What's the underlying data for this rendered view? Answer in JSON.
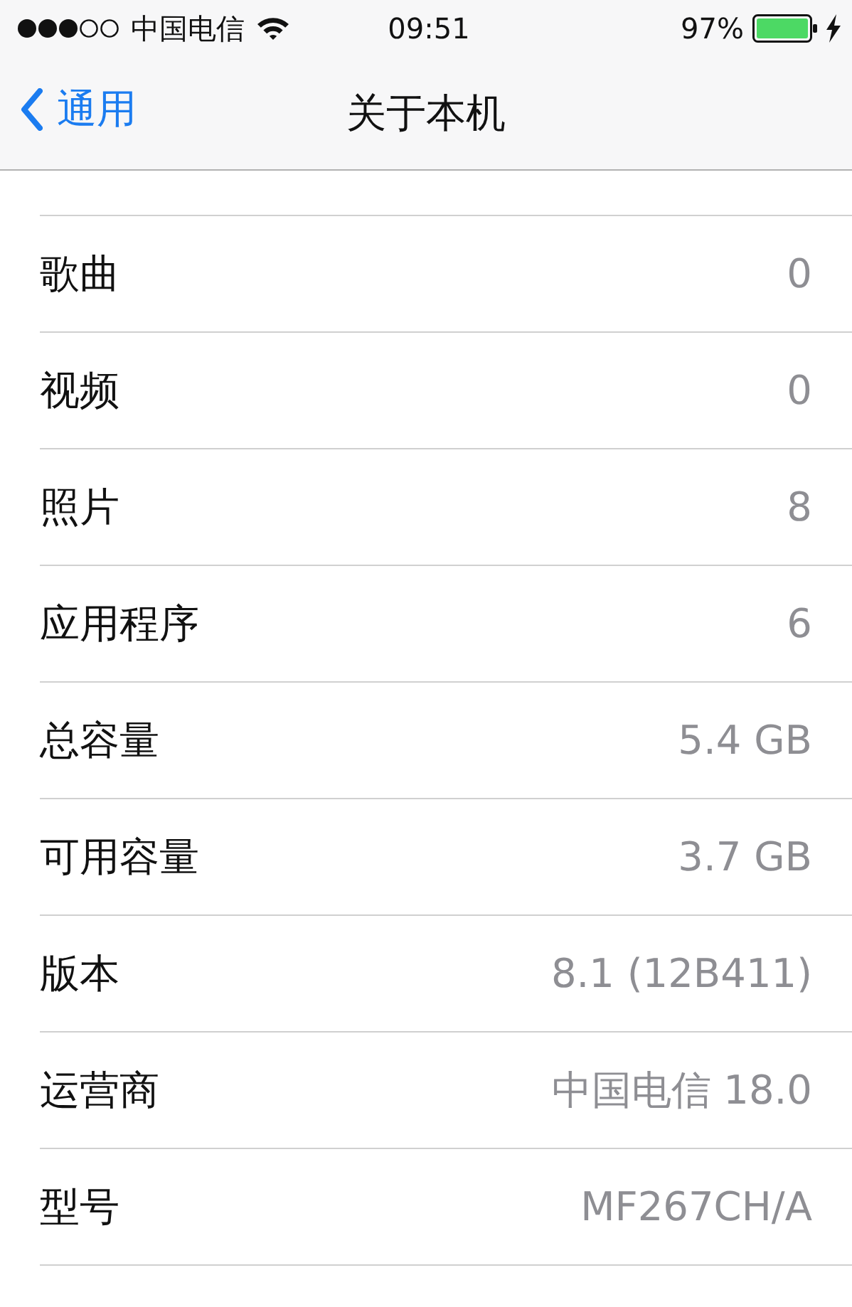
{
  "status_bar": {
    "carrier": "中国电信",
    "time": "09:51",
    "battery": "97%",
    "charging": true
  },
  "nav_bar": {
    "back": "通用",
    "title": "关于本机"
  },
  "rows": [
    {
      "label": "歌曲",
      "value": "0"
    },
    {
      "label": "视频",
      "value": "0"
    },
    {
      "label": "照片",
      "value": "8"
    },
    {
      "label": "应用程序",
      "value": "6"
    },
    {
      "label": "总容量",
      "value": "5.4 GB"
    },
    {
      "label": "可用容量",
      "value": "3.7 GB"
    },
    {
      "label": "版本",
      "value": "8.1 (12B411)"
    },
    {
      "label": "运营商",
      "value": "中国电信 18.0"
    },
    {
      "label": "型号",
      "value": "MF267CH/A"
    }
  ]
}
